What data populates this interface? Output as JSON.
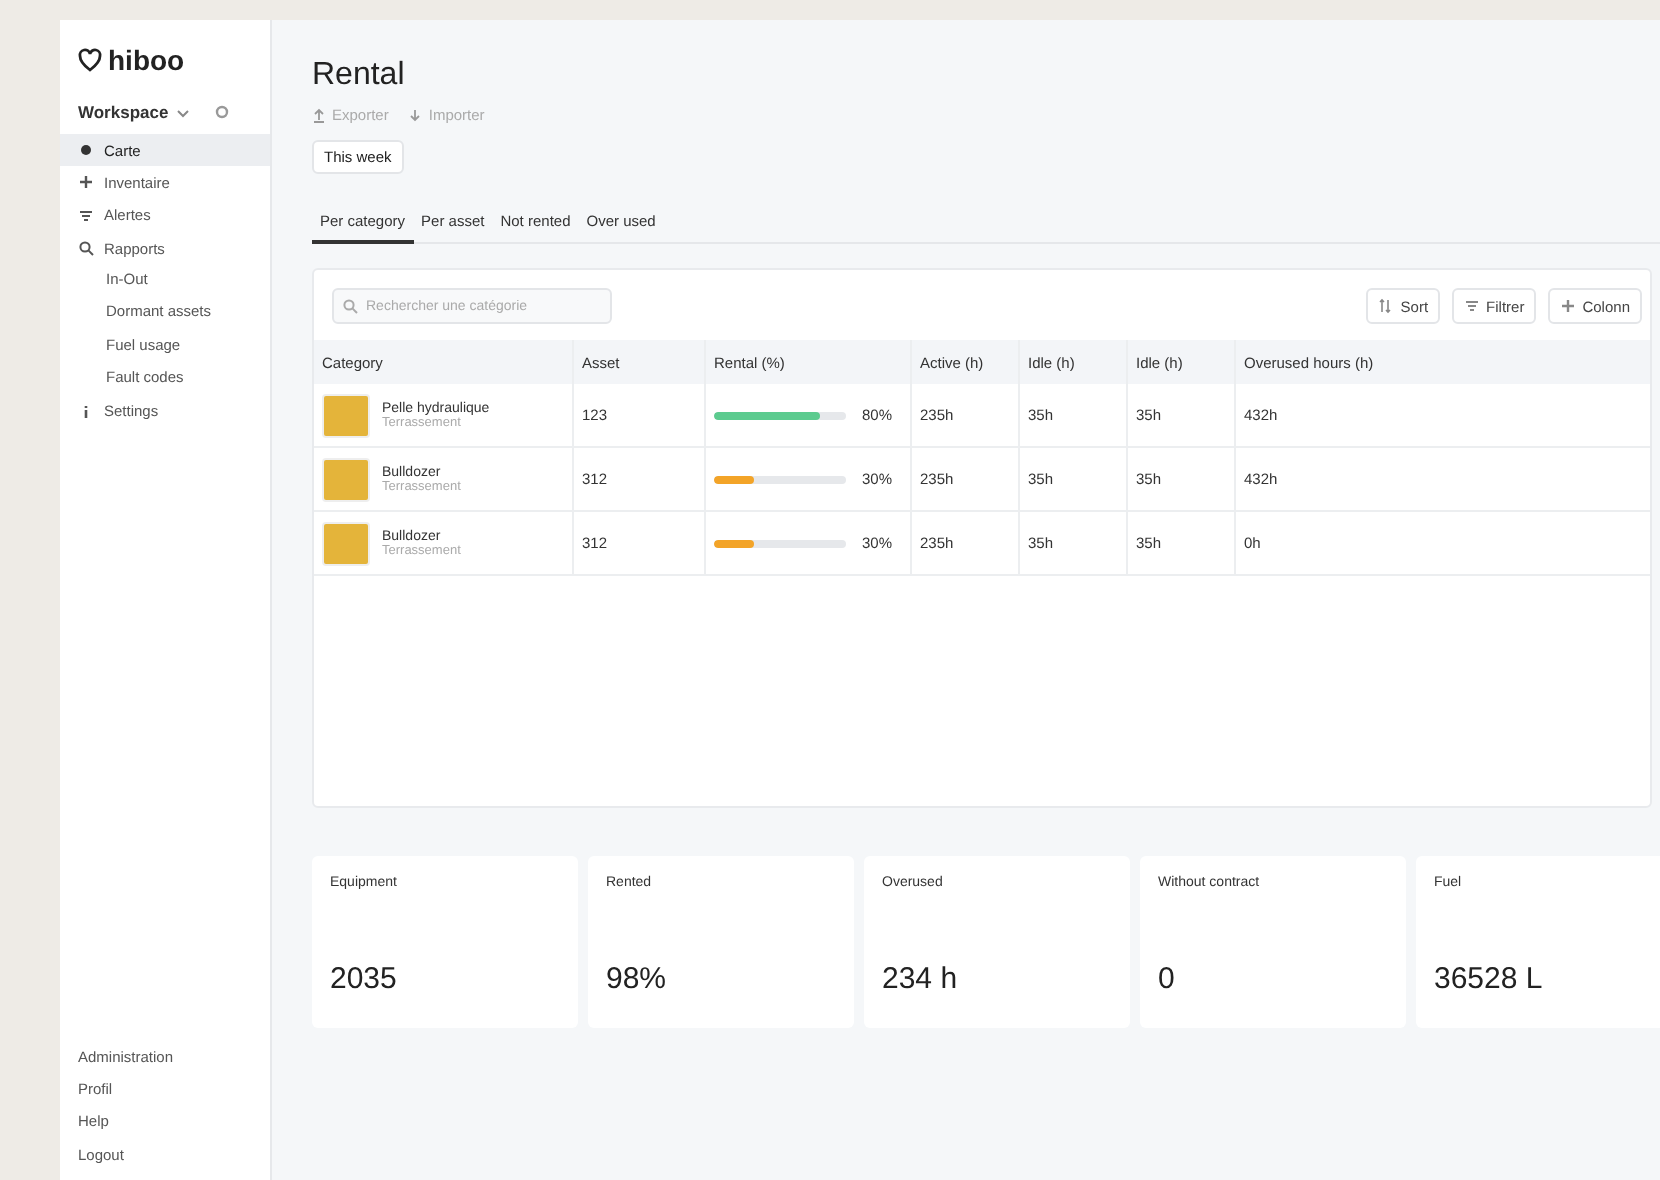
{
  "sidebar": {
    "logo": "hiboo",
    "workspace": "Workspace",
    "items": [
      {
        "label": "Carte",
        "selected": true
      },
      {
        "label": "Inventaire",
        "selected": false
      },
      {
        "label": "Alertes",
        "selected": false
      },
      {
        "label": "Rapports",
        "selected": false,
        "children": [
          {
            "label": "In-Out",
            "selected": false
          },
          {
            "label": "Dormant assets",
            "selected": false
          },
          {
            "label": "Fuel usage",
            "selected": false
          },
          {
            "label": "Fault codes",
            "selected": false
          }
        ]
      },
      {
        "label": "Settings",
        "selected": false
      }
    ],
    "footer": [
      "Administration",
      "Profil",
      "Help",
      "Logout"
    ]
  },
  "page": {
    "title": "Rental",
    "actions": [
      "Exporter",
      "Importer"
    ],
    "period": "This week"
  },
  "tabs": [
    {
      "label": "Per category",
      "selected": true
    },
    {
      "label": "Per asset",
      "selected": false
    },
    {
      "label": "Not rented",
      "selected": false
    },
    {
      "label": "Over used",
      "selected": false
    }
  ],
  "table": {
    "search": {
      "placeholder": "Rechercher une catégorie"
    },
    "tools": [
      "Sort",
      "Filtrer",
      "Colonn"
    ],
    "columns": [
      "Category",
      "Asset",
      "Rental (%)",
      "Active (h)",
      "Idle (h)",
      "Idle (h)",
      "Overused hours (h)"
    ],
    "rows": [
      {
        "name": "Pelle hydraulique",
        "group": "Terrassement",
        "asset": "123",
        "level": 0.8,
        "rental": "80%",
        "active": "235h",
        "idle_1": "35h",
        "idle_2": "35h",
        "overused": "432h"
      },
      {
        "name": "Bulldozer",
        "group": "Terrassement",
        "asset": "312",
        "level": 0.3,
        "rental": "30%",
        "active": "235h",
        "idle_1": "35h",
        "idle_2": "35h",
        "overused": "432h"
      },
      {
        "name": "Bulldozer",
        "group": "Terrassement",
        "asset": "312",
        "level": 0.3,
        "rental": "30%",
        "active": "235h",
        "idle_1": "35h",
        "idle_2": "35h",
        "overused": "0h"
      }
    ]
  },
  "kpis": [
    {
      "label": "Equipment",
      "value": "2035"
    },
    {
      "label": "Rented",
      "value": "98%"
    },
    {
      "label": "Overused",
      "value": "234 h"
    },
    {
      "label": "Without contract",
      "value": "0"
    },
    {
      "label": "Fuel",
      "value": "36528 L"
    }
  ]
}
